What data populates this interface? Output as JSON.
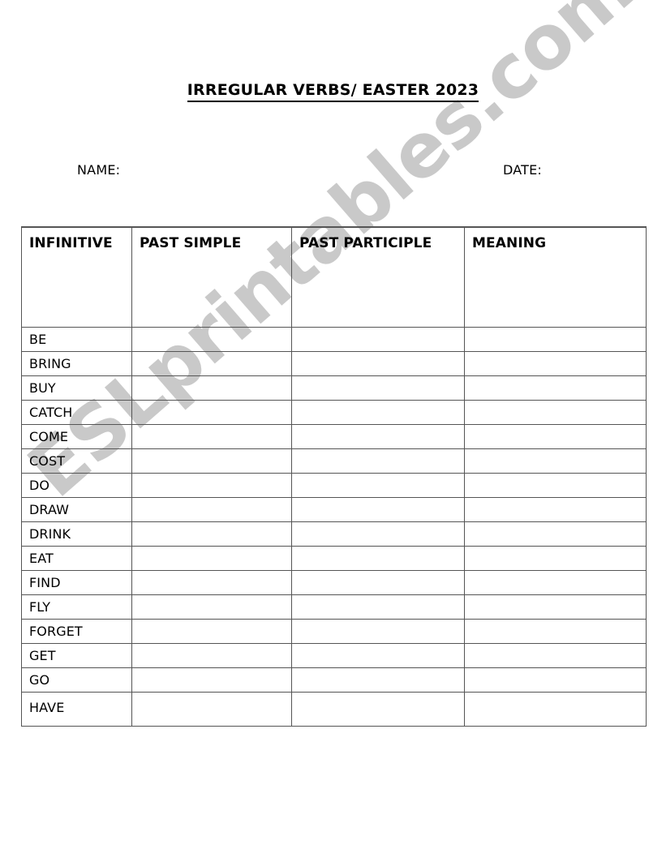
{
  "document": {
    "title": "IRREGULAR VERBS/ EASTER 2023",
    "name_label": "NAME:",
    "date_label": "DATE:"
  },
  "watermark": {
    "text": "ESLprintables.com",
    "color": "#c9c9c9"
  },
  "table": {
    "headers": [
      "INFINITIVE",
      "PAST SIMPLE",
      "PAST PARTICIPLE",
      "MEANING"
    ],
    "rows": [
      {
        "infinitive": "BE",
        "past_simple": "",
        "past_participle": "",
        "meaning": ""
      },
      {
        "infinitive": "BRING",
        "past_simple": "",
        "past_participle": "",
        "meaning": ""
      },
      {
        "infinitive": "BUY",
        "past_simple": "",
        "past_participle": "",
        "meaning": ""
      },
      {
        "infinitive": "CATCH",
        "past_simple": "",
        "past_participle": "",
        "meaning": ""
      },
      {
        "infinitive": "COME",
        "past_simple": "",
        "past_participle": "",
        "meaning": ""
      },
      {
        "infinitive": "COST",
        "past_simple": "",
        "past_participle": "",
        "meaning": ""
      },
      {
        "infinitive": "DO",
        "past_simple": "",
        "past_participle": "",
        "meaning": ""
      },
      {
        "infinitive": "DRAW",
        "past_simple": "",
        "past_participle": "",
        "meaning": ""
      },
      {
        "infinitive": "DRINK",
        "past_simple": "",
        "past_participle": "",
        "meaning": ""
      },
      {
        "infinitive": "EAT",
        "past_simple": "",
        "past_participle": "",
        "meaning": ""
      },
      {
        "infinitive": "FIND",
        "past_simple": "",
        "past_participle": "",
        "meaning": ""
      },
      {
        "infinitive": "FLY",
        "past_simple": "",
        "past_participle": "",
        "meaning": ""
      },
      {
        "infinitive": "FORGET",
        "past_simple": "",
        "past_participle": "",
        "meaning": ""
      },
      {
        "infinitive": "GET",
        "past_simple": "",
        "past_participle": "",
        "meaning": ""
      },
      {
        "infinitive": "GO",
        "past_simple": "",
        "past_participle": "",
        "meaning": ""
      },
      {
        "infinitive": "HAVE",
        "past_simple": "",
        "past_participle": "",
        "meaning": ""
      }
    ]
  }
}
